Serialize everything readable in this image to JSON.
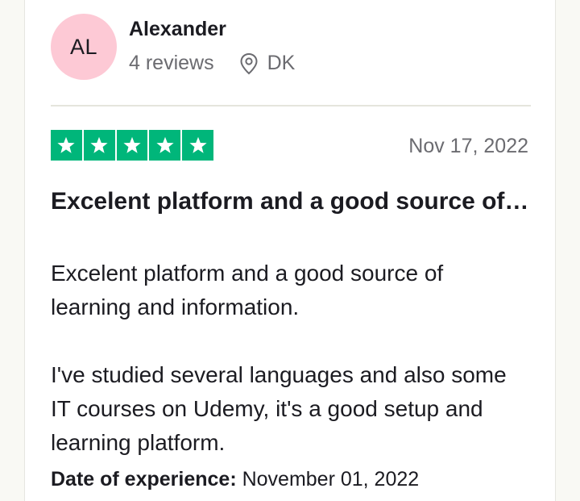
{
  "reviewer": {
    "initials": "AL",
    "name": "Alexander",
    "reviews": "4 reviews",
    "country": "DK",
    "avatar_color": "#fdc9d5"
  },
  "review": {
    "rating": 5,
    "max_rating": 5,
    "star_color": "#00b67a",
    "date": "Nov 17, 2022",
    "title": "Excelent platform and a good source of…",
    "paragraphs": [
      "Excelent platform and a good source of learning and information.",
      "I've studied several languages and also some IT courses on Udemy, it's a good setup and learning platform."
    ],
    "experience_label": "Date of experience:",
    "experience_date": "November 01, 2022"
  },
  "icons": {
    "location": "map-pin-icon",
    "star": "star-icon"
  }
}
